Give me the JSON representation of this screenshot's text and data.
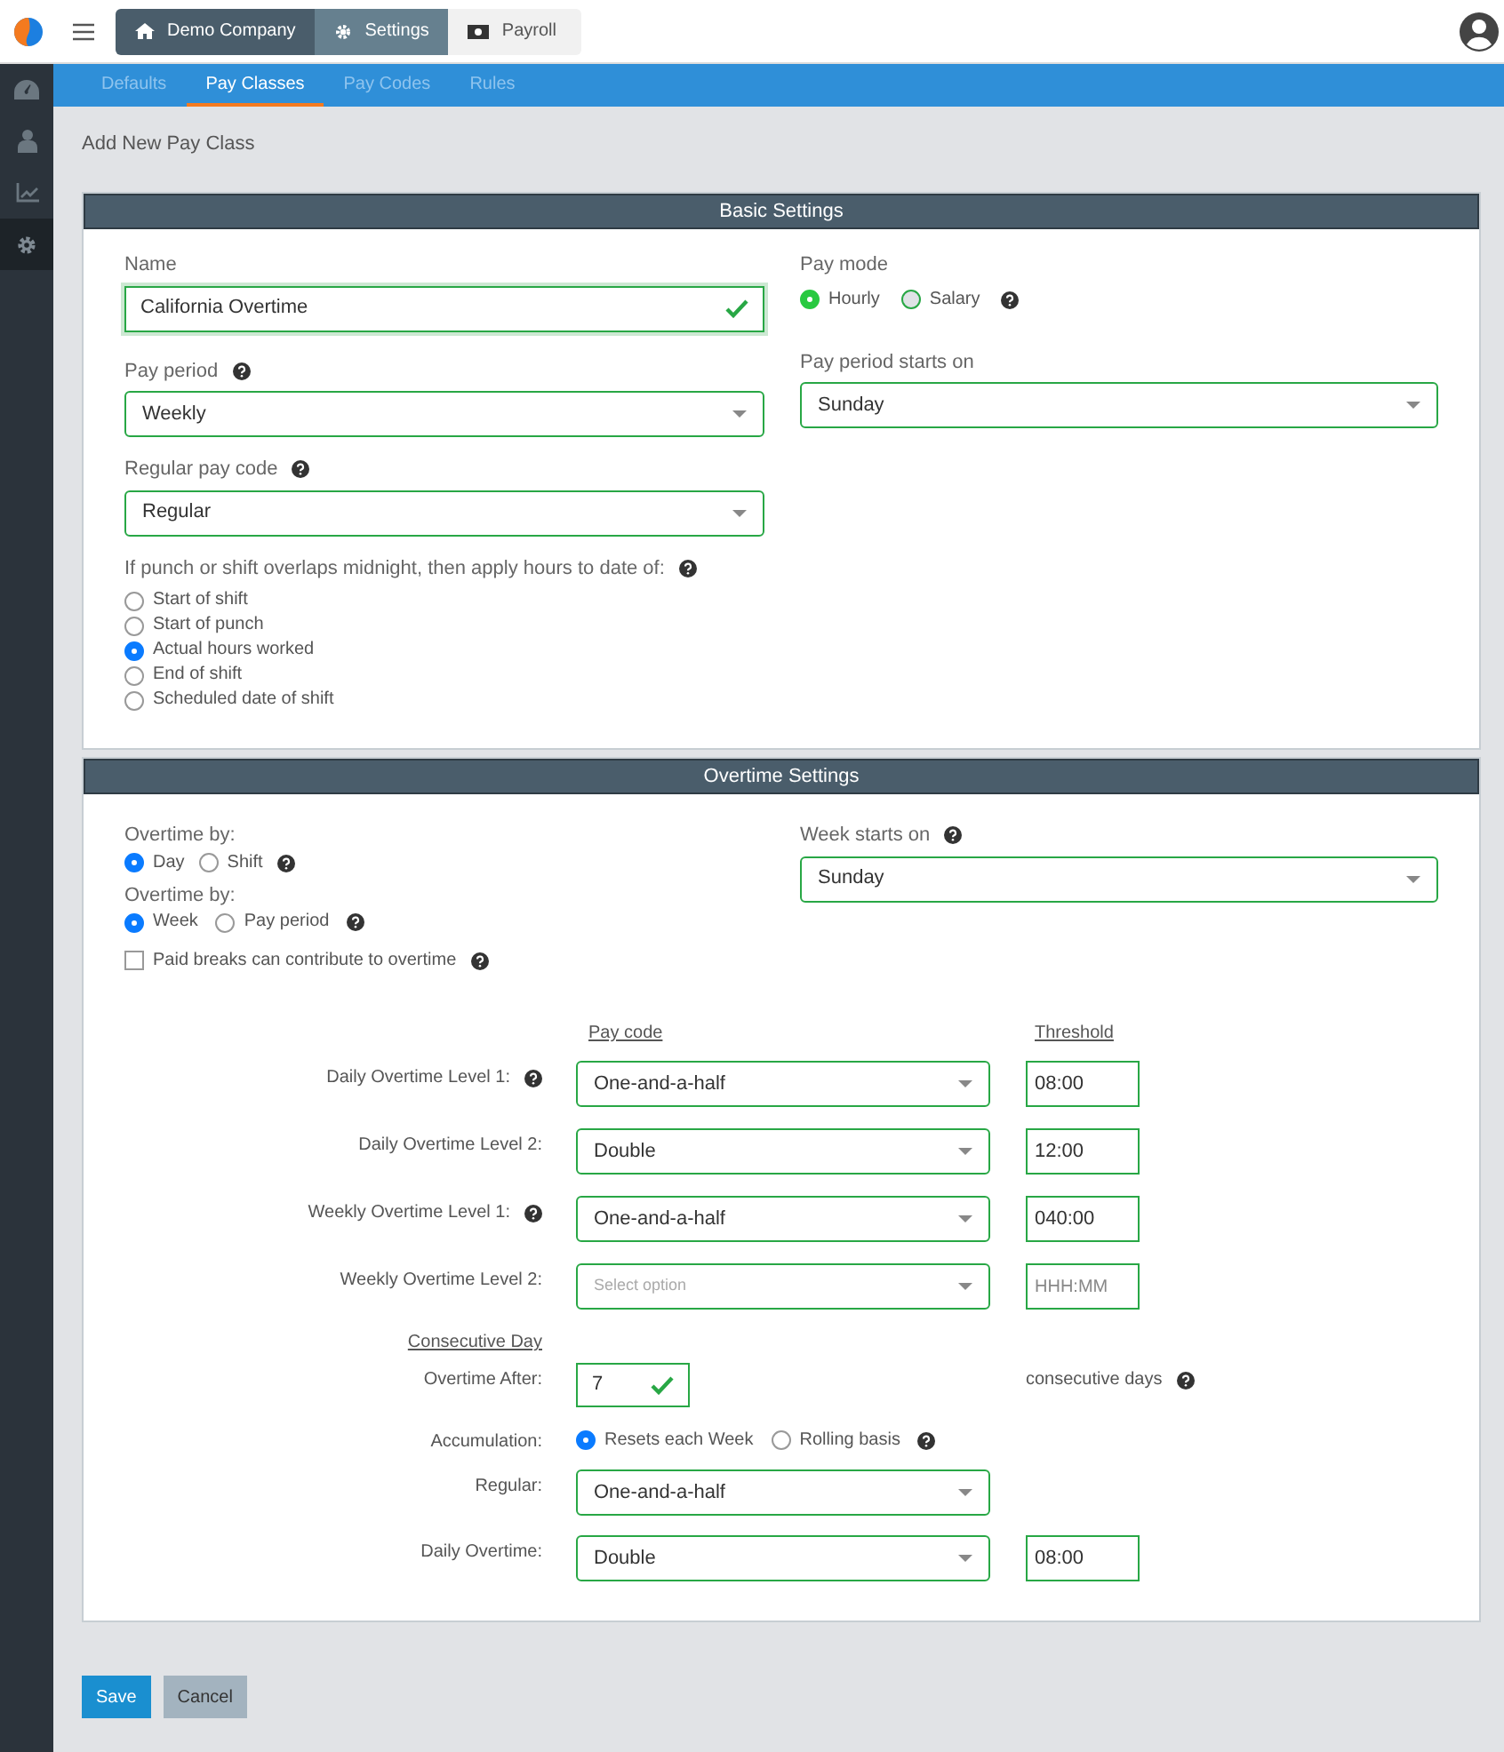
{
  "header": {
    "breadcrumbs": [
      {
        "label": "Demo Company"
      },
      {
        "label": "Settings"
      },
      {
        "label": "Payroll"
      }
    ]
  },
  "sidebar": {
    "items": [
      {
        "selected": false
      },
      {
        "selected": false
      },
      {
        "selected": false
      },
      {
        "selected": true
      }
    ]
  },
  "tabs": [
    {
      "label": "Defaults",
      "selected": false
    },
    {
      "label": "Pay Classes",
      "selected": true
    },
    {
      "label": "Pay Codes",
      "selected": false
    },
    {
      "label": "Rules",
      "selected": false
    }
  ],
  "page_title": "Add New Pay Class",
  "basic_settings": {
    "title": "Basic Settings",
    "name": {
      "label": "Name",
      "value": "California Overtime",
      "valid": true
    },
    "pay_mode": {
      "label": "Pay mode",
      "options": [
        {
          "label": "Hourly",
          "selected": true
        },
        {
          "label": "Salary",
          "selected": false
        }
      ]
    },
    "pay_period": {
      "label": "Pay period",
      "value": "Weekly"
    },
    "pay_period_starts_on": {
      "label": "Pay period starts on",
      "value": "Sunday"
    },
    "regular_pay_code": {
      "label": "Regular pay code",
      "value": "Regular"
    },
    "midnight_rule": {
      "label": "If punch or shift overlaps midnight, then apply hours to date of:",
      "options": [
        {
          "label": "Start of shift",
          "selected": false
        },
        {
          "label": "Start of punch",
          "selected": false
        },
        {
          "label": "Actual hours worked",
          "selected": true
        },
        {
          "label": "End of shift",
          "selected": false
        },
        {
          "label": "Scheduled date of shift",
          "selected": false
        }
      ]
    }
  },
  "overtime_settings": {
    "title": "Overtime Settings",
    "overtime_by_day": {
      "label": "Overtime by:",
      "options": [
        {
          "label": "Day",
          "selected": true
        },
        {
          "label": "Shift",
          "selected": false
        }
      ]
    },
    "overtime_by_week": {
      "label": "Overtime by:",
      "options": [
        {
          "label": "Week",
          "selected": true
        },
        {
          "label": "Pay period",
          "selected": false
        }
      ]
    },
    "week_starts_on": {
      "label": "Week starts on",
      "value": "Sunday"
    },
    "paid_breaks": {
      "label": "Paid breaks can contribute to overtime",
      "checked": false
    },
    "columns": [
      "Pay code",
      "Threshold"
    ],
    "levels": [
      {
        "label": "Daily Overtime Level 1:",
        "help": true,
        "value": "One-and-a-half",
        "threshold": "08:00"
      },
      {
        "label": "Daily Overtime Level 2:",
        "help": false,
        "value": "Double",
        "threshold": "12:00"
      },
      {
        "label": "Weekly Overtime Level 1:",
        "help": true,
        "value": "One-and-a-half",
        "threshold": "040:00"
      },
      {
        "label": "Weekly Overtime Level 2:",
        "help": false,
        "placeholder": "Select option",
        "threshold_placeholder": "HHH:MM"
      }
    ],
    "consecutive": {
      "title": "Consecutive Day",
      "overtime_after": {
        "label": "Overtime After:",
        "value": "7",
        "valid": true,
        "suffix": "consecutive days"
      },
      "accumulation": {
        "label": "Accumulation:",
        "options": [
          {
            "label": "Resets each Week",
            "selected": true
          },
          {
            "label": "Rolling basis",
            "selected": false
          }
        ]
      },
      "regular": {
        "label": "Regular:",
        "value": "One-and-a-half"
      },
      "daily_overtime": {
        "label": "Daily Overtime:",
        "value": "Double",
        "threshold": "08:00"
      }
    }
  },
  "buttons": [
    {
      "label": "Save",
      "kind": "primary"
    },
    {
      "label": "Cancel",
      "kind": "secondary"
    }
  ]
}
